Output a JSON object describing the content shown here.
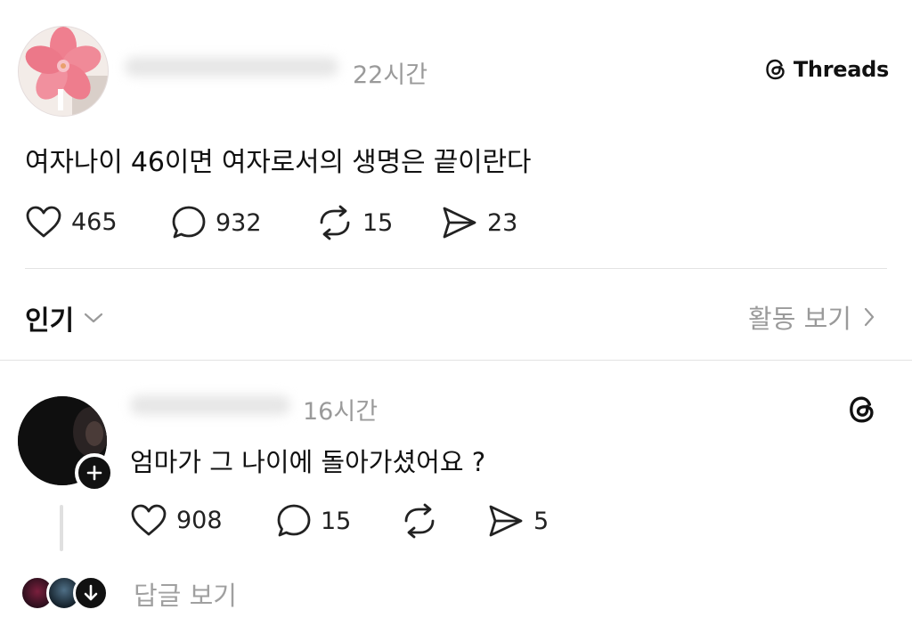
{
  "post": {
    "time": "22시간",
    "text": "여자나이 46이면 여자로서의 생명은 끝이란다",
    "actions": {
      "likes": "465",
      "comments": "932",
      "reposts": "15",
      "shares": "23"
    }
  },
  "brand": {
    "name": "Threads"
  },
  "sort": {
    "label": "인기",
    "activity_label": "활동 보기"
  },
  "reply": {
    "time": "16시간",
    "text": "엄마가 그 나이에 돌아가셨어요 ?",
    "actions": {
      "likes": "908",
      "comments": "15",
      "shares": "5"
    }
  },
  "footer": {
    "view_replies_label": "답글 보기"
  },
  "colors": {
    "text": "#111111",
    "muted": "#9a9a9a",
    "divider": "#e3e3e3"
  },
  "icons": [
    "heart-icon",
    "comment-icon",
    "repost-icon",
    "share-icon",
    "threads-logo-icon",
    "chevron-down-icon",
    "chevron-right-icon",
    "plus-icon",
    "arrow-down-icon"
  ]
}
